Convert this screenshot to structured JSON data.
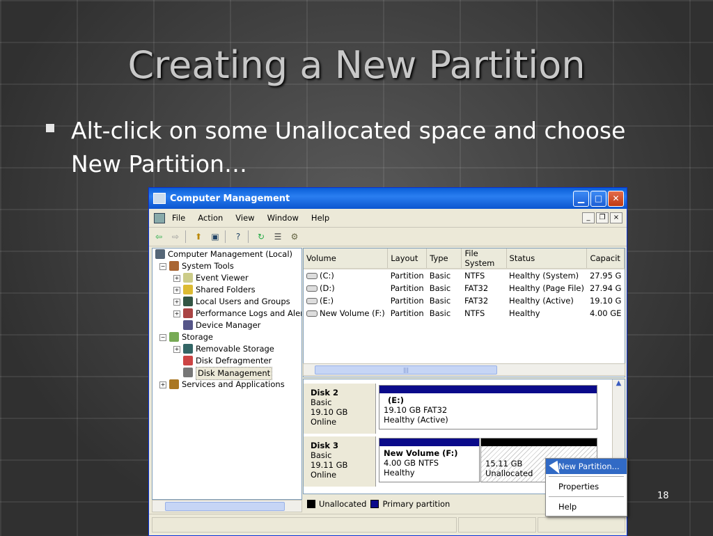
{
  "slide": {
    "title": "Creating a New Partition",
    "bullet": "Alt-click on some Unallocated space and choose New Partition…",
    "page_number": "18"
  },
  "window": {
    "title": "Computer Management",
    "menu": [
      "File",
      "Action",
      "View",
      "Window",
      "Help"
    ],
    "tree": {
      "items": [
        {
          "label": "Computer Management (Local)",
          "level": 0,
          "expander": "",
          "icon": "computer-icon"
        },
        {
          "label": "System Tools",
          "level": 1,
          "expander": "−",
          "icon": "tools-icon"
        },
        {
          "label": "Event Viewer",
          "level": 2,
          "expander": "+",
          "icon": "event-viewer-icon"
        },
        {
          "label": "Shared Folders",
          "level": 2,
          "expander": "+",
          "icon": "shared-folders-icon"
        },
        {
          "label": "Local Users and Groups",
          "level": 2,
          "expander": "+",
          "icon": "users-icon"
        },
        {
          "label": "Performance Logs and Alerts",
          "level": 2,
          "expander": "+",
          "icon": "performance-icon"
        },
        {
          "label": "Device Manager",
          "level": 2,
          "expander": "",
          "icon": "device-manager-icon"
        },
        {
          "label": "Storage",
          "level": 1,
          "expander": "−",
          "icon": "storage-icon"
        },
        {
          "label": "Removable Storage",
          "level": 2,
          "expander": "+",
          "icon": "removable-storage-icon"
        },
        {
          "label": "Disk Defragmenter",
          "level": 2,
          "expander": "",
          "icon": "defrag-icon"
        },
        {
          "label": "Disk Management",
          "level": 2,
          "expander": "",
          "icon": "disk-management-icon",
          "selected": true
        },
        {
          "label": "Services and Applications",
          "level": 1,
          "expander": "+",
          "icon": "services-icon"
        }
      ]
    },
    "volumes": {
      "columns": [
        "Volume",
        "Layout",
        "Type",
        "File System",
        "Status",
        "Capacit"
      ],
      "rows": [
        [
          "(C:)",
          "Partition",
          "Basic",
          "NTFS",
          "Healthy (System)",
          "27.95 G"
        ],
        [
          "(D:)",
          "Partition",
          "Basic",
          "FAT32",
          "Healthy (Page File)",
          "27.94 G"
        ],
        [
          "(E:)",
          "Partition",
          "Basic",
          "FAT32",
          "Healthy (Active)",
          "19.10 G"
        ],
        [
          "New Volume (F:)",
          "Partition",
          "Basic",
          "NTFS",
          "Healthy",
          "4.00 GE"
        ]
      ],
      "scroll_thumb": "|||"
    },
    "disks": [
      {
        "name": "Disk 2",
        "type": "Basic",
        "size": "19.10 GB",
        "state": "Online",
        "partitions": [
          {
            "label": "(E:)",
            "detail": "19.10 GB FAT32",
            "status": "Healthy (Active)",
            "kind": "primary"
          }
        ]
      },
      {
        "name": "Disk 3",
        "type": "Basic",
        "size": "19.11 GB",
        "state": "Online",
        "partitions": [
          {
            "label": "New Volume  (F:)",
            "detail": "4.00 GB NTFS",
            "status": "Healthy",
            "kind": "primary"
          },
          {
            "label": "",
            "detail": "15.11 GB",
            "status": "Unallocated",
            "kind": "unallocated"
          }
        ]
      }
    ],
    "legend": [
      {
        "label": "Unallocated",
        "color": "#000000"
      },
      {
        "label": "Primary partition",
        "color": "#0a0a8a"
      }
    ],
    "context_menu": [
      "New Partition...",
      "Properties",
      "Help"
    ]
  },
  "colors": {
    "primary_bar": "#0a0a8a",
    "unallocated_bar": "#000000",
    "menu_highlight": "#316ac5",
    "titlebar": "#0a5fd8"
  }
}
